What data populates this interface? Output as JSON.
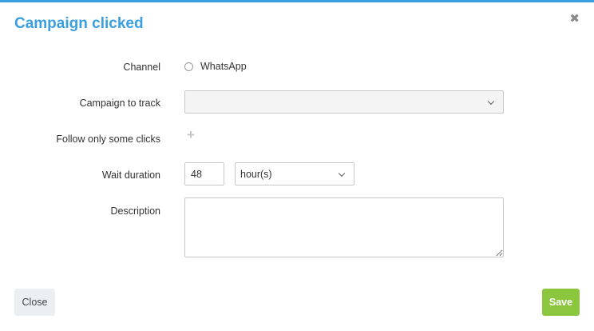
{
  "dialog": {
    "title": "Campaign clicked",
    "close_icon": "close-icon",
    "accent_color": "#3a9fe0"
  },
  "form": {
    "channel": {
      "label": "Channel",
      "option_label": "WhatsApp",
      "selected": false
    },
    "campaign": {
      "label": "Campaign to track",
      "value": ""
    },
    "follow_clicks": {
      "label": "Follow only some clicks",
      "add_icon": "plus-icon",
      "add_symbol": "+"
    },
    "wait_duration": {
      "label": "Wait duration",
      "value": "48",
      "unit": "hour(s)"
    },
    "description": {
      "label": "Description",
      "value": ""
    }
  },
  "footer": {
    "close_label": "Close",
    "save_label": "Save",
    "save_color": "#8cc63f"
  }
}
